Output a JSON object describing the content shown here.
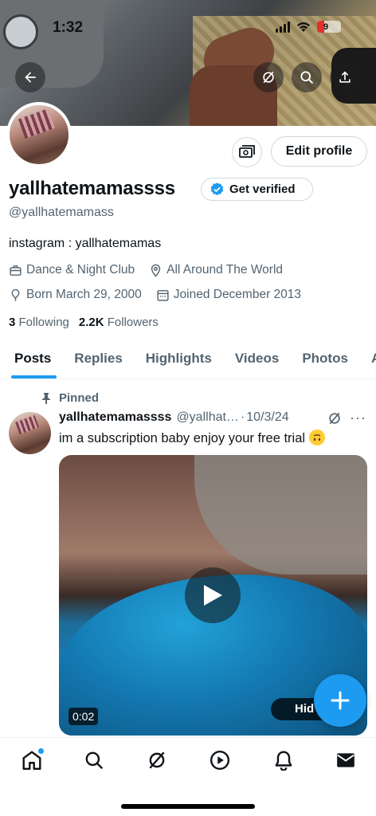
{
  "status_bar": {
    "time": "1:32",
    "battery": "9"
  },
  "profile": {
    "display_name": "yallhatemamassss",
    "handle": "@yallhatemamass",
    "bio": "instagram : yallhatemamas",
    "category": "Dance & Night Club",
    "location": "All Around The World",
    "born": "Born March 29, 2000",
    "joined": "Joined December 2013",
    "following_count": "3",
    "following_label": "Following",
    "followers_count": "2.2K",
    "followers_label": "Followers"
  },
  "buttons": {
    "edit_profile": "Edit profile",
    "get_verified": "Get verified"
  },
  "tabs": [
    {
      "label": "Posts"
    },
    {
      "label": "Replies"
    },
    {
      "label": "Highlights"
    },
    {
      "label": "Videos"
    },
    {
      "label": "Photos"
    },
    {
      "label": "Art"
    }
  ],
  "pinned_tweet": {
    "pinned_label": "Pinned",
    "name": "yallhatemamassss",
    "handle": "@yallhat…",
    "separator": "·",
    "date": "10/3/24",
    "more": "···",
    "text": "im a subscription baby enjoy your free trial ",
    "video_duration": "0:02",
    "hide_label": "Hid"
  },
  "colors": {
    "accent": "#1d9bf0",
    "text": "#0f1419",
    "secondary": "#536471"
  }
}
